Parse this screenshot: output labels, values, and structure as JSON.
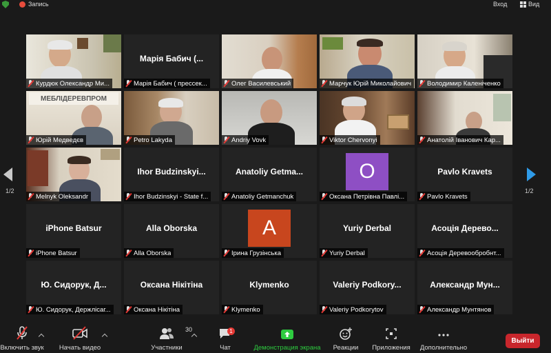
{
  "topbar": {
    "record_label": "Запись",
    "enter_label": "Вход",
    "view_label": "Вид"
  },
  "tiles": [
    {
      "name": "Курдюк Олександр Ми..."
    },
    {
      "name": "Марія Бабич ( прессек...",
      "display": "Марія Бабич (..."
    },
    {
      "name": "Олег Василевський"
    },
    {
      "name": "Марчук Юрій Миколайович"
    },
    {
      "name": "Володимир Каленіченко"
    },
    {
      "name": "Юрій Медведєв",
      "sign": "МЕБЛІДЕРЕВПРОМ"
    },
    {
      "name": "Petro Lakyda"
    },
    {
      "name": "Andriy Vovk"
    },
    {
      "name": "Viktor Chervonyi"
    },
    {
      "name": "Анатолій Іванович Кар..."
    },
    {
      "name": "Melnyk Oleksandr"
    },
    {
      "name": "Ihor Budzinskyi - State f...",
      "display": "Ihor  Budzinskyi..."
    },
    {
      "name": "Anatoliy Getmanchuk",
      "display": "Anatoliy  Getma..."
    },
    {
      "name": "Оксана Петрівна Павлі...",
      "avatar": "О",
      "avatar_color": "#8e4fc4"
    },
    {
      "name": "Pavlo Kravets",
      "display": "Pavlo Kravets"
    },
    {
      "name": "iPhone Batsur",
      "display": "iPhone Batsur"
    },
    {
      "name": "Alla Oborska",
      "display": "Alla Oborska"
    },
    {
      "name": "Ірина Грузінська",
      "avatar": "А",
      "avatar_color": "#c8461e"
    },
    {
      "name": "Yuriy Derbal",
      "display": "Yuriy Derbal"
    },
    {
      "name": "Асоція Деревообробнт...",
      "display": "Асоція Дерево..."
    },
    {
      "name": "Ю. Сидорук,  Держлісаг...",
      "display": "Ю.  Сидорук,   Д..."
    },
    {
      "name": "Оксана Нікітіна",
      "display": "Оксана Нікітіна"
    },
    {
      "name": "Klymenko",
      "display": "Klymenko"
    },
    {
      "name": "Valeriy Podkorytov",
      "display": "Valeriy  Podkory..."
    },
    {
      "name": "Александр Мунтянов",
      "display": "Александр  Мун..."
    }
  ],
  "pager": {
    "left": "1/2",
    "right": "1/2"
  },
  "toolbar": {
    "audio_label": "Включить звук",
    "video_label": "Начать видео",
    "participants_label": "Участники",
    "participants_count": "30",
    "chat_label": "Чат",
    "chat_badge": "1",
    "share_label": "Демонстрация экрана",
    "reactions_label": "Реакции",
    "apps_label": "Приложения",
    "more_label": "Дополнительно",
    "leave_label": "Выйти"
  },
  "colors": {
    "accent_green": "#2ecc40",
    "active_speaker_border": "#9ad33a",
    "leave_red": "#c8262c",
    "pager_blue": "#2f9be8"
  }
}
